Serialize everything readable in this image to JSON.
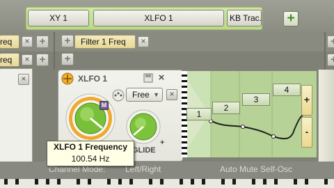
{
  "top_tabs": {
    "tab1": "XY 1",
    "tab2": "XLFO 1",
    "tab3": "KB Trac...",
    "add": "+"
  },
  "row2": {
    "left_chip_top": "req",
    "left_chip_bottom": "req",
    "filter_chip": "Filter 1 Freq",
    "close": "×",
    "add": "+"
  },
  "xlfo_panel": {
    "title": "XLFO 1",
    "mode_badge": "M",
    "free_select": "Free",
    "glide_label": "GLIDE",
    "close": "×"
  },
  "envelope": {
    "stages": [
      "1",
      "2",
      "3",
      "4"
    ],
    "add": "+",
    "remove": "-",
    "curve_points": [
      [
        1,
        55
      ],
      [
        2,
        50
      ],
      [
        3,
        45
      ],
      [
        4,
        55
      ]
    ]
  },
  "tooltip": {
    "title": "XLFO 1 Frequency",
    "value": "100.54 Hz"
  },
  "status_row": {
    "channel_mode_label": "Channel Mode:",
    "channel_mode_value": "Left/Right",
    "auto_mute": "Auto Mute Self-Osc"
  },
  "colors": {
    "tab_bar_green": "#bada86",
    "chip_yellow": "#efe3ab",
    "knob_orange": "#f0a830",
    "knob_green": "#7cc23a",
    "envelope_bg": "#b8d49a"
  }
}
